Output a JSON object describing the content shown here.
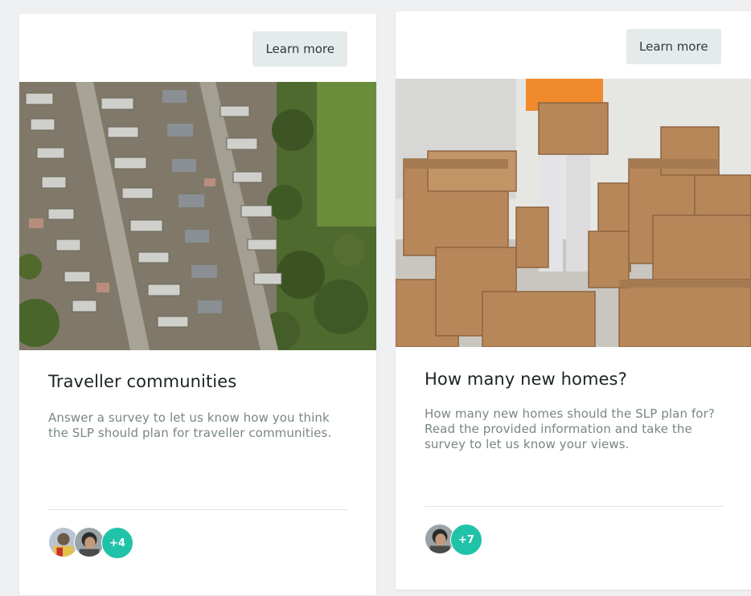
{
  "colors": {
    "background": "#eef0f2",
    "card": "#ffffff",
    "button_bg": "#e5ebea",
    "title": "#1c2424",
    "description": "#7a8687",
    "count_badge": "#21c3a8"
  },
  "cards": [
    {
      "button_label": "Learn more",
      "image": "aerial-traveller-site-photo",
      "title": "Traveller communities",
      "description": "Answer a survey to let us know how you think the SLP should plan for traveller communities.",
      "participants_more": "+4"
    },
    {
      "button_label": "Learn more",
      "image": "moving-boxes-photo",
      "title": "How many new homes?",
      "description": "How many new homes should the SLP plan for? Read the provided information and take the survey to let us know your views.",
      "participants_more": "+7"
    }
  ]
}
